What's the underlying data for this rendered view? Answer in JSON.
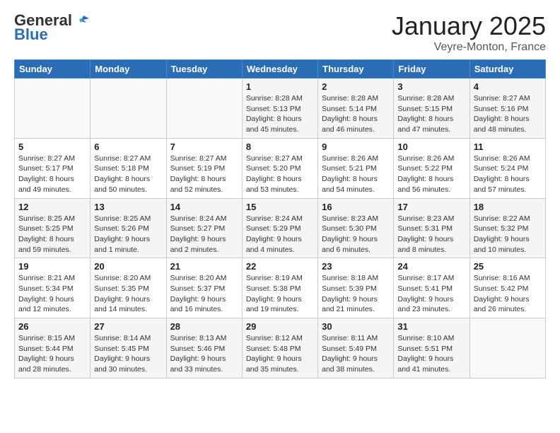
{
  "header": {
    "logo_line1": "General",
    "logo_line2": "Blue",
    "month": "January 2025",
    "location": "Veyre-Monton, France"
  },
  "weekdays": [
    "Sunday",
    "Monday",
    "Tuesday",
    "Wednesday",
    "Thursday",
    "Friday",
    "Saturday"
  ],
  "weeks": [
    [
      {
        "day": "",
        "sunrise": "",
        "sunset": "",
        "daylight": ""
      },
      {
        "day": "",
        "sunrise": "",
        "sunset": "",
        "daylight": ""
      },
      {
        "day": "",
        "sunrise": "",
        "sunset": "",
        "daylight": ""
      },
      {
        "day": "1",
        "sunrise": "Sunrise: 8:28 AM",
        "sunset": "Sunset: 5:13 PM",
        "daylight": "Daylight: 8 hours and 45 minutes."
      },
      {
        "day": "2",
        "sunrise": "Sunrise: 8:28 AM",
        "sunset": "Sunset: 5:14 PM",
        "daylight": "Daylight: 8 hours and 46 minutes."
      },
      {
        "day": "3",
        "sunrise": "Sunrise: 8:28 AM",
        "sunset": "Sunset: 5:15 PM",
        "daylight": "Daylight: 8 hours and 47 minutes."
      },
      {
        "day": "4",
        "sunrise": "Sunrise: 8:27 AM",
        "sunset": "Sunset: 5:16 PM",
        "daylight": "Daylight: 8 hours and 48 minutes."
      }
    ],
    [
      {
        "day": "5",
        "sunrise": "Sunrise: 8:27 AM",
        "sunset": "Sunset: 5:17 PM",
        "daylight": "Daylight: 8 hours and 49 minutes."
      },
      {
        "day": "6",
        "sunrise": "Sunrise: 8:27 AM",
        "sunset": "Sunset: 5:18 PM",
        "daylight": "Daylight: 8 hours and 50 minutes."
      },
      {
        "day": "7",
        "sunrise": "Sunrise: 8:27 AM",
        "sunset": "Sunset: 5:19 PM",
        "daylight": "Daylight: 8 hours and 52 minutes."
      },
      {
        "day": "8",
        "sunrise": "Sunrise: 8:27 AM",
        "sunset": "Sunset: 5:20 PM",
        "daylight": "Daylight: 8 hours and 53 minutes."
      },
      {
        "day": "9",
        "sunrise": "Sunrise: 8:26 AM",
        "sunset": "Sunset: 5:21 PM",
        "daylight": "Daylight: 8 hours and 54 minutes."
      },
      {
        "day": "10",
        "sunrise": "Sunrise: 8:26 AM",
        "sunset": "Sunset: 5:22 PM",
        "daylight": "Daylight: 8 hours and 56 minutes."
      },
      {
        "day": "11",
        "sunrise": "Sunrise: 8:26 AM",
        "sunset": "Sunset: 5:24 PM",
        "daylight": "Daylight: 8 hours and 57 minutes."
      }
    ],
    [
      {
        "day": "12",
        "sunrise": "Sunrise: 8:25 AM",
        "sunset": "Sunset: 5:25 PM",
        "daylight": "Daylight: 8 hours and 59 minutes."
      },
      {
        "day": "13",
        "sunrise": "Sunrise: 8:25 AM",
        "sunset": "Sunset: 5:26 PM",
        "daylight": "Daylight: 9 hours and 1 minute."
      },
      {
        "day": "14",
        "sunrise": "Sunrise: 8:24 AM",
        "sunset": "Sunset: 5:27 PM",
        "daylight": "Daylight: 9 hours and 2 minutes."
      },
      {
        "day": "15",
        "sunrise": "Sunrise: 8:24 AM",
        "sunset": "Sunset: 5:29 PM",
        "daylight": "Daylight: 9 hours and 4 minutes."
      },
      {
        "day": "16",
        "sunrise": "Sunrise: 8:23 AM",
        "sunset": "Sunset: 5:30 PM",
        "daylight": "Daylight: 9 hours and 6 minutes."
      },
      {
        "day": "17",
        "sunrise": "Sunrise: 8:23 AM",
        "sunset": "Sunset: 5:31 PM",
        "daylight": "Daylight: 9 hours and 8 minutes."
      },
      {
        "day": "18",
        "sunrise": "Sunrise: 8:22 AM",
        "sunset": "Sunset: 5:32 PM",
        "daylight": "Daylight: 9 hours and 10 minutes."
      }
    ],
    [
      {
        "day": "19",
        "sunrise": "Sunrise: 8:21 AM",
        "sunset": "Sunset: 5:34 PM",
        "daylight": "Daylight: 9 hours and 12 minutes."
      },
      {
        "day": "20",
        "sunrise": "Sunrise: 8:20 AM",
        "sunset": "Sunset: 5:35 PM",
        "daylight": "Daylight: 9 hours and 14 minutes."
      },
      {
        "day": "21",
        "sunrise": "Sunrise: 8:20 AM",
        "sunset": "Sunset: 5:37 PM",
        "daylight": "Daylight: 9 hours and 16 minutes."
      },
      {
        "day": "22",
        "sunrise": "Sunrise: 8:19 AM",
        "sunset": "Sunset: 5:38 PM",
        "daylight": "Daylight: 9 hours and 19 minutes."
      },
      {
        "day": "23",
        "sunrise": "Sunrise: 8:18 AM",
        "sunset": "Sunset: 5:39 PM",
        "daylight": "Daylight: 9 hours and 21 minutes."
      },
      {
        "day": "24",
        "sunrise": "Sunrise: 8:17 AM",
        "sunset": "Sunset: 5:41 PM",
        "daylight": "Daylight: 9 hours and 23 minutes."
      },
      {
        "day": "25",
        "sunrise": "Sunrise: 8:16 AM",
        "sunset": "Sunset: 5:42 PM",
        "daylight": "Daylight: 9 hours and 26 minutes."
      }
    ],
    [
      {
        "day": "26",
        "sunrise": "Sunrise: 8:15 AM",
        "sunset": "Sunset: 5:44 PM",
        "daylight": "Daylight: 9 hours and 28 minutes."
      },
      {
        "day": "27",
        "sunrise": "Sunrise: 8:14 AM",
        "sunset": "Sunset: 5:45 PM",
        "daylight": "Daylight: 9 hours and 30 minutes."
      },
      {
        "day": "28",
        "sunrise": "Sunrise: 8:13 AM",
        "sunset": "Sunset: 5:46 PM",
        "daylight": "Daylight: 9 hours and 33 minutes."
      },
      {
        "day": "29",
        "sunrise": "Sunrise: 8:12 AM",
        "sunset": "Sunset: 5:48 PM",
        "daylight": "Daylight: 9 hours and 35 minutes."
      },
      {
        "day": "30",
        "sunrise": "Sunrise: 8:11 AM",
        "sunset": "Sunset: 5:49 PM",
        "daylight": "Daylight: 9 hours and 38 minutes."
      },
      {
        "day": "31",
        "sunrise": "Sunrise: 8:10 AM",
        "sunset": "Sunset: 5:51 PM",
        "daylight": "Daylight: 9 hours and 41 minutes."
      },
      {
        "day": "",
        "sunrise": "",
        "sunset": "",
        "daylight": ""
      }
    ]
  ]
}
